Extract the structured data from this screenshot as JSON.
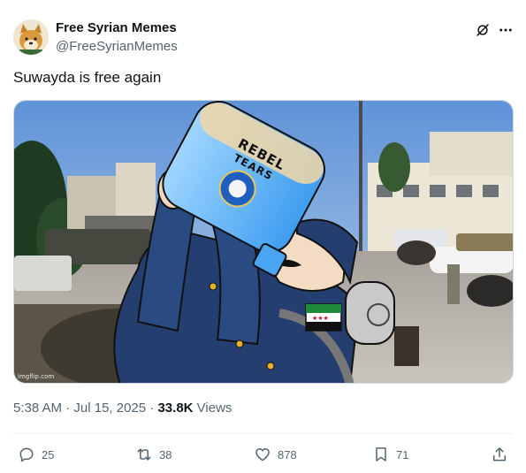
{
  "account": {
    "display_name": "Free Syrian Memes",
    "handle": "@FreeSyrianMemes"
  },
  "tweet": {
    "text": "Suwayda is free again",
    "time": "5:38 AM",
    "separator": "·",
    "date": "Jul 15, 2025",
    "views_count": "33.8K",
    "views_label": "Views"
  },
  "media": {
    "caption_words": [
      "REBEL",
      "TEARS"
    ],
    "watermark": "imgflip.com"
  },
  "actions": {
    "replies": "25",
    "reposts": "38",
    "likes": "878",
    "bookmarks": "71"
  },
  "icons": [
    "grok-icon",
    "more-icon",
    "reply-icon",
    "repost-icon",
    "like-icon",
    "bookmark-icon",
    "share-icon"
  ]
}
